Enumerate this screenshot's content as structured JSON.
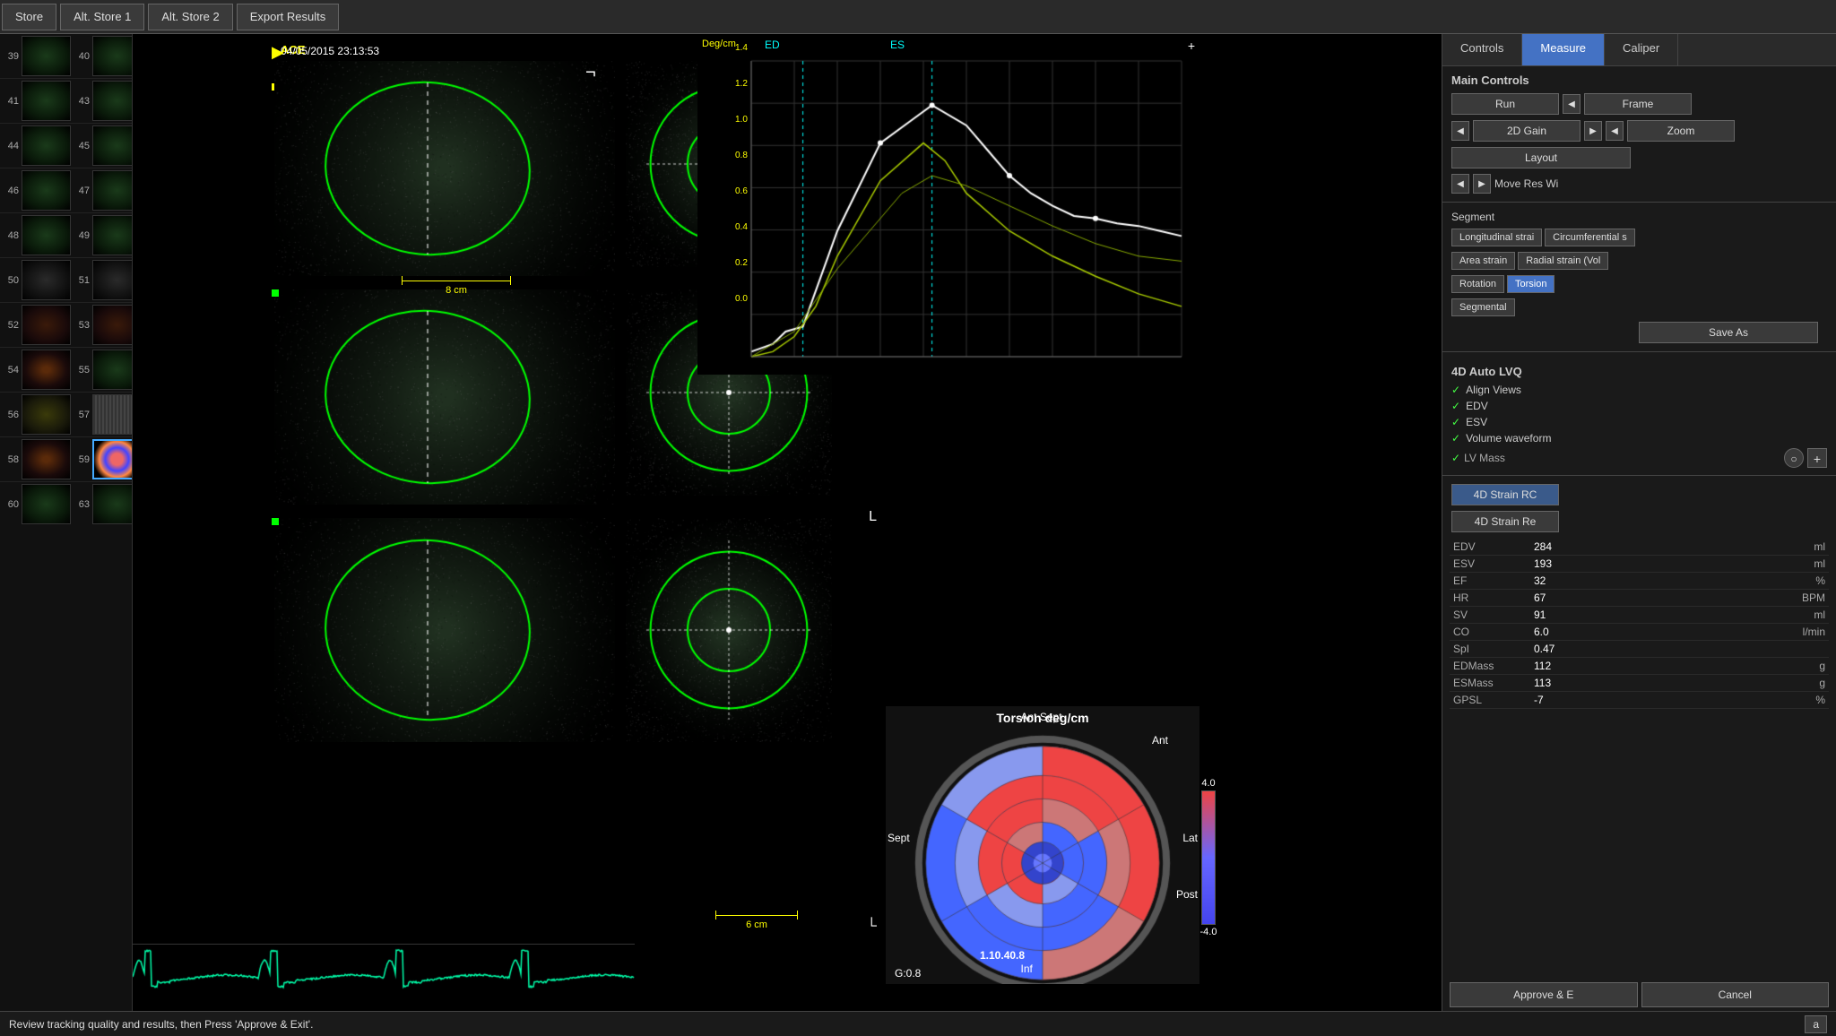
{
  "topbar": {
    "buttons": [
      "Store",
      "Alt. Store 1",
      "Alt. Store 2",
      "Export Results"
    ]
  },
  "imaging": {
    "label": "ACE",
    "datetime": "04/05/2015 23:13:53",
    "ruler1_label": "8 cm",
    "ruler2_label": "6 cm"
  },
  "graph": {
    "y_label": "Deg/cm",
    "ed_label": "ED",
    "es_label": "ES",
    "y_values": [
      "1.4",
      "1.2",
      "1.0",
      "0.8",
      "0.6",
      "0.4",
      "0.2",
      "0.0"
    ]
  },
  "polar": {
    "title": "Torsion deg/cm",
    "labels": {
      "ant_sept": "Ant Sept",
      "sept": "Sept",
      "inf": "Inf",
      "post": "Post",
      "lat": "Lat",
      "ant": "Ant"
    },
    "g_value": "G:0.8",
    "strain_value": "1.10.40.8",
    "scale_max": "4.0",
    "scale_min": "-4.0"
  },
  "tabs": {
    "controls": "Controls",
    "measure": "Measure",
    "caliper": "Caliper"
  },
  "right_panel": {
    "main_controls_title": "Main Controls",
    "run_label": "Run",
    "frame_label": "Frame",
    "gain_label": "2D Gain",
    "zoom_label": "Zoom",
    "layout_label": "Layout",
    "move_res_label": "Move Res Wi",
    "segment_label": "Segment",
    "seg_buttons": [
      "Longitudinal strai",
      "Circumferential s",
      "Area strain",
      "Radial strain (Vol",
      "Rotation",
      "Torsion",
      "Segmental"
    ],
    "save_as_label": "Save As",
    "auto_lvq_title": "4D Auto LVQ",
    "align_views_label": "Align Views",
    "edv_label": "EDV",
    "esv_label": "ESV",
    "volume_waveform_label": "Volume waveform",
    "lv_mass_label": "LV Mass",
    "strain_rc1_label": "4D Strain RC",
    "strain_re_label": "4D Strain Re",
    "approve_label": "Approve & E",
    "cancel_label": "Cancel",
    "data": [
      {
        "key": "EDV",
        "value": "284",
        "unit": "ml"
      },
      {
        "key": "ESV",
        "value": "193",
        "unit": "ml"
      },
      {
        "key": "EF",
        "value": "32",
        "unit": "%"
      },
      {
        "key": "HR",
        "value": "67",
        "unit": "BPM"
      },
      {
        "key": "SV",
        "value": "91",
        "unit": "ml"
      },
      {
        "key": "CO",
        "value": "6.0",
        "unit": "l/min"
      },
      {
        "key": "SpI",
        "value": "0.47",
        "unit": ""
      },
      {
        "key": "EDMass",
        "value": "112",
        "unit": "g"
      },
      {
        "key": "ESMass",
        "value": "113",
        "unit": "g"
      },
      {
        "key": "GPSL",
        "value": "-7",
        "unit": "%"
      }
    ]
  },
  "status_bar": {
    "message": "Review tracking quality and results, then Press 'Approve & Exit'.",
    "shortcut": "a"
  },
  "thumbnails": [
    {
      "top": "39",
      "bot": "40"
    },
    {
      "top": "41",
      "bot": "43"
    },
    {
      "top": "44",
      "bot": "45"
    },
    {
      "top": "46",
      "bot": "47"
    },
    {
      "top": "48",
      "bot": "49"
    },
    {
      "top": "50",
      "bot": "51"
    },
    {
      "top": "52",
      "bot": "53"
    },
    {
      "top": "54",
      "bot": "55"
    },
    {
      "top": "56",
      "bot": "57"
    },
    {
      "top": "58",
      "bot": "59"
    },
    {
      "top": "60",
      "bot": "63"
    }
  ]
}
